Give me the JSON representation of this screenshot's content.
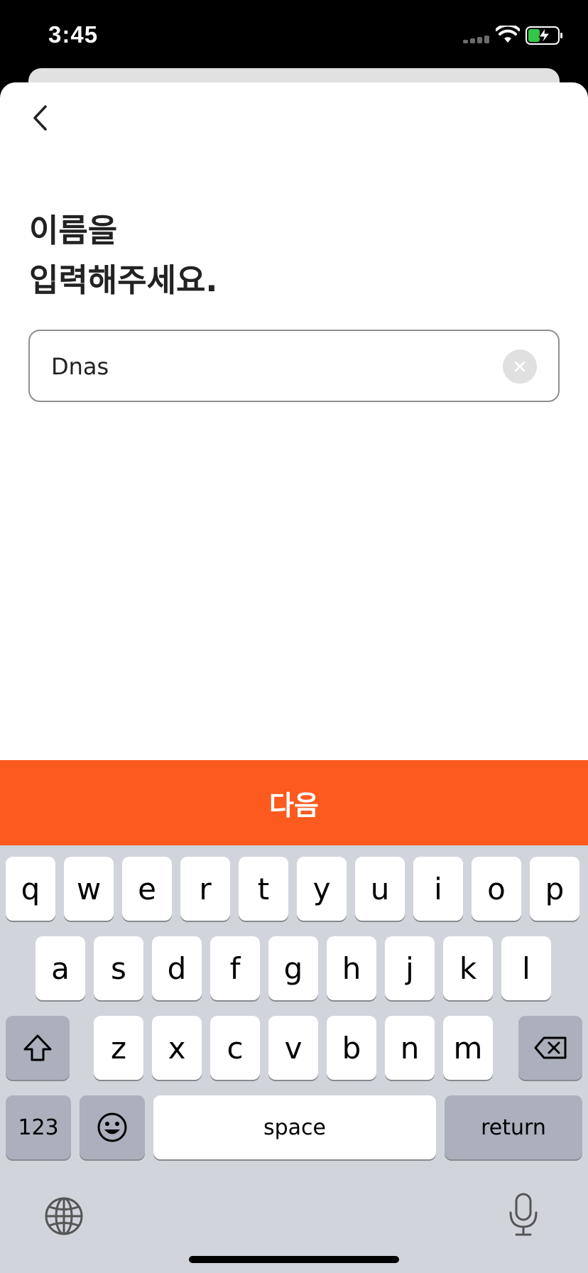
{
  "status_bar": {
    "time": "3:45",
    "icons": [
      "signal-icon",
      "wifi-icon",
      "battery-charging-icon"
    ]
  },
  "header": {
    "back_icon": "chevron-left-icon"
  },
  "main": {
    "title": "이름을\n입력해주세요.",
    "name_input": {
      "value": "Dnas",
      "clear_icon": "clear-x-icon"
    }
  },
  "action": {
    "next_label": "다음",
    "color": "#fc5a1f"
  },
  "keyboard": {
    "row1": [
      "q",
      "w",
      "e",
      "r",
      "t",
      "y",
      "u",
      "i",
      "o",
      "p"
    ],
    "row2": [
      "a",
      "s",
      "d",
      "f",
      "g",
      "h",
      "j",
      "k",
      "l"
    ],
    "row3": [
      "z",
      "x",
      "c",
      "v",
      "b",
      "n",
      "m"
    ],
    "numbers_label": "123",
    "space_label": "space",
    "return_label": "return",
    "icons": [
      "shift-icon",
      "backspace-icon",
      "emoji-icon",
      "globe-icon",
      "microphone-icon"
    ]
  }
}
